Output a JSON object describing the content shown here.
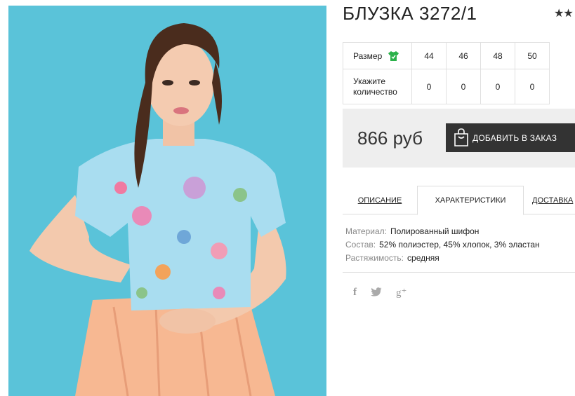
{
  "product": {
    "title": "БЛУЗКА 3272/1",
    "rating_stars": "★★",
    "photo_icon": "product-photo"
  },
  "sizes": {
    "size_label": "Размер",
    "size_icon": "shirt-icon",
    "qty_label_line1": "Укажите",
    "qty_label_line2": "количество",
    "columns": [
      "44",
      "46",
      "48",
      "50"
    ],
    "quantities": [
      "0",
      "0",
      "0",
      "0"
    ]
  },
  "purchase": {
    "price": "866 руб",
    "add_button_label": "ДОБАВИТЬ В ЗАКАЗ",
    "add_button_icon": "shopping-bag-icon",
    "panel_color": "#eeeeee",
    "button_color": "#333333"
  },
  "tabs": [
    {
      "label": "ОПИСАНИЕ",
      "active": false
    },
    {
      "label": "ХАРАКТЕРИСТИКИ",
      "active": true
    },
    {
      "label": "ДОСТАВКА",
      "active": false
    }
  ],
  "specs": [
    {
      "key": "Материал:",
      "value": "Полированный шифон"
    },
    {
      "key": "Состав:",
      "value": "52% полиэстер, 45% хлопок, 3% эластан"
    },
    {
      "key": "Растяжимость:",
      "value": "средняя"
    }
  ],
  "social": {
    "facebook": "f",
    "twitter": "🐦",
    "googleplus": "g⁺",
    "icons": [
      "facebook-icon",
      "twitter-icon",
      "googleplus-icon"
    ]
  },
  "colors": {
    "photo_background": "#5ac3d9",
    "accent_green": "#2bb14a"
  }
}
